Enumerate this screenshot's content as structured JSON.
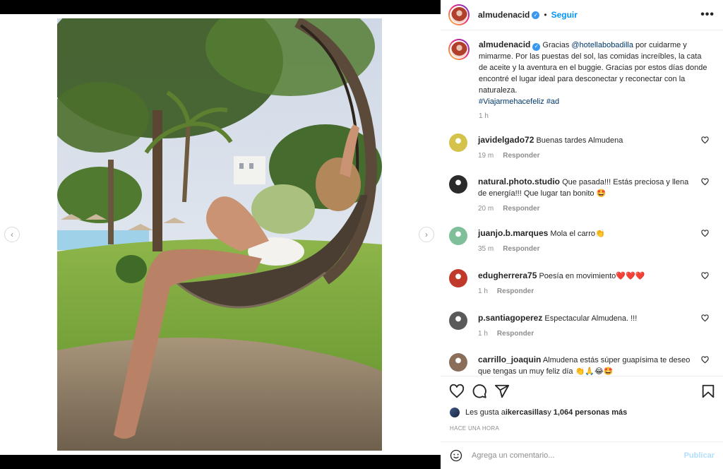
{
  "post": {
    "username": "almudenacid",
    "follow_label": "Seguir",
    "more_label": "•••",
    "caption": {
      "username": "almudenacid",
      "text_1": " Gracias ",
      "mention": "@hotellabobadilla",
      "text_2": " por cuidarme y mimarme. Por las puestas del sol, las comidas increíbles, la cata de aceite y la aventura en el buggie. Gracias por estos días donde encontré el lugar ideal para desconectar y reconectar con la naturaleza.",
      "hashtag_1": "#Viajarmehacefeliz",
      "hashtag_2": "#ad",
      "time": "1 h"
    }
  },
  "reply_label": "Responder",
  "comments": [
    {
      "user": "javidelgado72",
      "text": "Buenas tardes Almudena",
      "time": "19 m",
      "avatar_color": "#d4c24a"
    },
    {
      "user": "natural.photo.studio",
      "text": "Que pasada!!! Estás preciosa y llena de energía!!! Que lugar tan bonito 🤩",
      "time": "20 m",
      "avatar_color": "#2b2b2b"
    },
    {
      "user": "juanjo.b.marques",
      "text": "Mola el carro👏",
      "time": "35 m",
      "avatar_color": "#7fbf9a"
    },
    {
      "user": "edugherrera75",
      "text": "Poesía en movimiento❤️❤️❤️",
      "time": "1 h",
      "avatar_color": "#c0392b"
    },
    {
      "user": "p.santiagoperez",
      "text": "Espectacular Almudena. !!!",
      "time": "1 h",
      "avatar_color": "#5a5a5a"
    },
    {
      "user": "carrillo_joaquin",
      "text": "Almudena estás súper guapísima te deseo que tengas un muy feliz día 👏🙏😂🤩",
      "time": "",
      "avatar_color": "#8a6e5a"
    }
  ],
  "likes": {
    "prefix": "Les gusta a ",
    "user": "ikercasillas",
    "middle": " y ",
    "count": "1,064 personas más"
  },
  "time_ago": "HACE UNA HORA",
  "add_comment": {
    "placeholder": "Agrega un comentario...",
    "publish_label": "Publicar"
  },
  "icons": {
    "prev": "chevron-left-icon",
    "next": "chevron-right-icon",
    "like": "heart-icon",
    "comment": "comment-icon",
    "share": "send-icon",
    "save": "bookmark-icon",
    "emoji": "emoji-icon"
  },
  "colors": {
    "accent": "#0095f6",
    "verified": "#3897f0",
    "link": "#00376b",
    "muted": "#8e8e8e"
  }
}
